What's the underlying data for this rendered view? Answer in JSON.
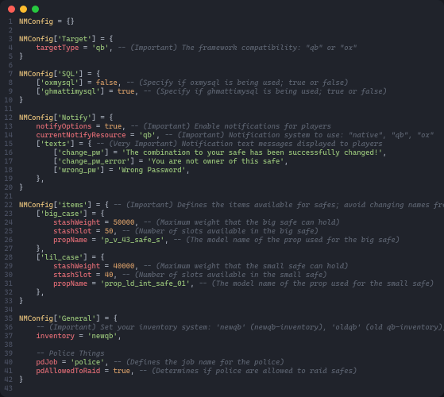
{
  "window": {
    "traffic": [
      "close",
      "minimize",
      "zoom"
    ]
  },
  "lines": [
    [
      [
        "id",
        "NMConfig"
      ],
      [
        "p",
        " = {}"
      ]
    ],
    [],
    [
      [
        "id",
        "NMConfig"
      ],
      [
        "p",
        "["
      ],
      [
        "s",
        "'Target'"
      ],
      [
        "p",
        "] = {"
      ]
    ],
    [
      [
        "p",
        "    "
      ],
      [
        "k",
        "targetType"
      ],
      [
        "p",
        " = "
      ],
      [
        "s",
        "'qb'"
      ],
      [
        "p",
        ", "
      ],
      [
        "c",
        "-- (Important) The framework compatibility: \"qb\" or \"ox\""
      ]
    ],
    [
      [
        "p",
        "}"
      ]
    ],
    [],
    [
      [
        "id",
        "NMConfig"
      ],
      [
        "p",
        "["
      ],
      [
        "s",
        "'SQL'"
      ],
      [
        "p",
        "] = {"
      ]
    ],
    [
      [
        "p",
        "    ["
      ],
      [
        "s",
        "'oxmysql'"
      ],
      [
        "p",
        "] = "
      ],
      [
        "b",
        "false"
      ],
      [
        "p",
        ", "
      ],
      [
        "c",
        "-- (Specify if oxmysql is being used; true or false)"
      ]
    ],
    [
      [
        "p",
        "    ["
      ],
      [
        "s",
        "'ghmattimysql'"
      ],
      [
        "p",
        "] = "
      ],
      [
        "b",
        "true"
      ],
      [
        "p",
        ", "
      ],
      [
        "c",
        "-- (Specify if ghmattimysql is being used; true or false)"
      ]
    ],
    [
      [
        "p",
        "}"
      ]
    ],
    [],
    [
      [
        "id",
        "NMConfig"
      ],
      [
        "p",
        "["
      ],
      [
        "s",
        "'Notify'"
      ],
      [
        "p",
        "] = {"
      ]
    ],
    [
      [
        "p",
        "    "
      ],
      [
        "k",
        "notifyOptions"
      ],
      [
        "p",
        " = "
      ],
      [
        "b",
        "true"
      ],
      [
        "p",
        ", "
      ],
      [
        "c",
        "-- (Important) Enable notifications for players"
      ]
    ],
    [
      [
        "p",
        "    "
      ],
      [
        "k",
        "currentNotifyResource"
      ],
      [
        "p",
        " = "
      ],
      [
        "s",
        "'qb'"
      ],
      [
        "p",
        ", "
      ],
      [
        "c",
        "-- (Important) Notification system to use: \"native\", \"qb\", \"ox\""
      ]
    ],
    [
      [
        "p",
        "    ["
      ],
      [
        "s",
        "'texts'"
      ],
      [
        "p",
        "] = { "
      ],
      [
        "c",
        "-- (Very Important) Notification text messages displayed to players"
      ]
    ],
    [
      [
        "p",
        "        ["
      ],
      [
        "s",
        "'change_pw'"
      ],
      [
        "p",
        "] = "
      ],
      [
        "s",
        "'The combination to your safe has been successfully changed!'"
      ],
      [
        "p",
        ","
      ]
    ],
    [
      [
        "p",
        "        ["
      ],
      [
        "s",
        "'change_pw_error'"
      ],
      [
        "p",
        "] = "
      ],
      [
        "s",
        "'You are not owner of this safe'"
      ],
      [
        "p",
        ","
      ]
    ],
    [
      [
        "p",
        "        ["
      ],
      [
        "s",
        "'wrong_pw'"
      ],
      [
        "p",
        "] = "
      ],
      [
        "s",
        "'Wrong Password'"
      ],
      [
        "p",
        ","
      ]
    ],
    [
      [
        "p",
        "    },"
      ]
    ],
    [
      [
        "p",
        "}"
      ]
    ],
    [],
    [
      [
        "id",
        "NMConfig"
      ],
      [
        "p",
        "["
      ],
      [
        "s",
        "'items'"
      ],
      [
        "p",
        "] = { "
      ],
      [
        "c",
        "-- (Important) Defines the items available for safes; avoid changing names frequently"
      ]
    ],
    [
      [
        "p",
        "    ["
      ],
      [
        "s",
        "'big_case'"
      ],
      [
        "p",
        "] = {"
      ]
    ],
    [
      [
        "p",
        "        "
      ],
      [
        "k",
        "stashWeight"
      ],
      [
        "p",
        " = "
      ],
      [
        "n",
        "50000"
      ],
      [
        "p",
        ", "
      ],
      [
        "c",
        "-- (Maximum weight that the big safe can hold)"
      ]
    ],
    [
      [
        "p",
        "        "
      ],
      [
        "k",
        "stashSlot"
      ],
      [
        "p",
        " = "
      ],
      [
        "n",
        "50"
      ],
      [
        "p",
        ", "
      ],
      [
        "c",
        "-- (Number of slots available in the big safe)"
      ]
    ],
    [
      [
        "p",
        "        "
      ],
      [
        "k",
        "propName"
      ],
      [
        "p",
        " = "
      ],
      [
        "s",
        "'p_v_43_safe_s'"
      ],
      [
        "p",
        ", "
      ],
      [
        "c",
        "-- (The model name of the prop used for the big safe)"
      ]
    ],
    [
      [
        "p",
        "    },"
      ]
    ],
    [
      [
        "p",
        "    ["
      ],
      [
        "s",
        "'lil_case'"
      ],
      [
        "p",
        "] = {"
      ]
    ],
    [
      [
        "p",
        "        "
      ],
      [
        "k",
        "stashWeight"
      ],
      [
        "p",
        " = "
      ],
      [
        "n",
        "40000"
      ],
      [
        "p",
        ", "
      ],
      [
        "c",
        "-- (Maximum weight that the small safe can hold)"
      ]
    ],
    [
      [
        "p",
        "        "
      ],
      [
        "k",
        "stashSlot"
      ],
      [
        "p",
        " = "
      ],
      [
        "n",
        "40"
      ],
      [
        "p",
        ", "
      ],
      [
        "c",
        "-- (Number of slots available in the small safe)"
      ]
    ],
    [
      [
        "p",
        "        "
      ],
      [
        "k",
        "propName"
      ],
      [
        "p",
        " = "
      ],
      [
        "s",
        "'prop_ld_int_safe_01'"
      ],
      [
        "p",
        ", "
      ],
      [
        "c",
        "-- (The model name of the prop used for the small safe)"
      ]
    ],
    [
      [
        "p",
        "    },"
      ]
    ],
    [
      [
        "p",
        "}"
      ]
    ],
    [],
    [
      [
        "id",
        "NMConfig"
      ],
      [
        "p",
        "["
      ],
      [
        "s",
        "'General'"
      ],
      [
        "p",
        "] = {"
      ]
    ],
    [
      [
        "p",
        "    "
      ],
      [
        "c",
        "-- (Important) Set your inventory system: 'newqb' (newqb-inventory), 'oldqb' (old qb-inventory), 'ox' (ox inventory)"
      ]
    ],
    [
      [
        "p",
        "    "
      ],
      [
        "k",
        "inventory"
      ],
      [
        "p",
        " = "
      ],
      [
        "s",
        "'newqb'"
      ],
      [
        "p",
        ","
      ]
    ],
    [],
    [
      [
        "p",
        "    "
      ],
      [
        "c",
        "-- Police Things"
      ]
    ],
    [
      [
        "p",
        "    "
      ],
      [
        "k",
        "pdJob"
      ],
      [
        "p",
        " = "
      ],
      [
        "s",
        "'police'"
      ],
      [
        "p",
        ", "
      ],
      [
        "c",
        "-- (Defines the job name for the police)"
      ]
    ],
    [
      [
        "p",
        "    "
      ],
      [
        "k",
        "pdAllowedToRaid"
      ],
      [
        "p",
        " = "
      ],
      [
        "b",
        "true"
      ],
      [
        "p",
        ", "
      ],
      [
        "c",
        "-- (Determines if police are allowed to raid safes)"
      ]
    ],
    [
      [
        "p",
        "}"
      ]
    ],
    []
  ]
}
